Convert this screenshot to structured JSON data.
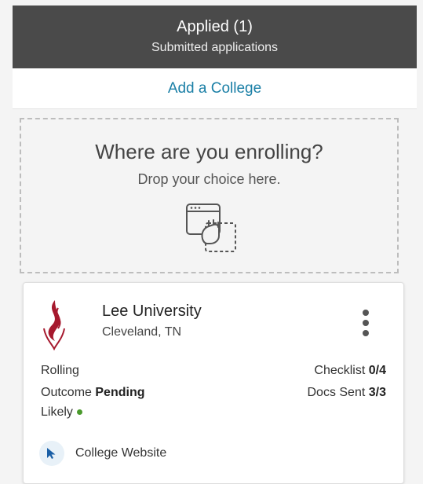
{
  "header": {
    "title": "Applied (1)",
    "subtitle": "Submitted applications"
  },
  "add_college": {
    "label": "Add a College"
  },
  "dropzone": {
    "title": "Where are you enrolling?",
    "subtitle": "Drop your choice here."
  },
  "college_card": {
    "name": "Lee University",
    "location": "Cleveland, TN",
    "deadline_type": "Rolling",
    "outcome_label": "Outcome",
    "outcome_value": "Pending",
    "likelihood": "Likely",
    "checklist_label": "Checklist",
    "checklist_value": "0/4",
    "docs_label": "Docs Sent",
    "docs_value": "3/3",
    "website_label": "College Website"
  },
  "colors": {
    "header_bg": "#4a4a4a",
    "link": "#1a7fa6",
    "brand_red": "#a6192e",
    "likely_dot": "#4a9a2c",
    "pointer_blue": "#1a5fa6"
  }
}
